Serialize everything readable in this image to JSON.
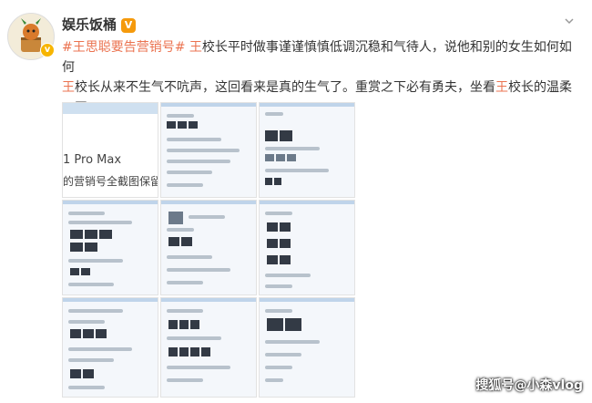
{
  "post": {
    "author": "娱乐饭桶",
    "vip_badge": "V",
    "text": {
      "hashtag": "#王思聪要告营销号#",
      "p1_hl": "王",
      "p1_rest": "校长平时做事谨谨慎慎低调沉稳和气待人，说他和别的女生如何如何",
      "p2_hl": "王",
      "p2_rest": "校长从来不生气不吭声，这回看来是真的生气了。重赏之下必有勇夫，坐看",
      "p2_hl2": "王",
      "p2_end": "校长的温柔一刀"
    }
  },
  "screenshots": {
    "tile1_line1": "1 Pro Max",
    "tile1_line2": "的营销号全截图保留"
  },
  "watermark": "搜狐号@小森vlog",
  "colors": {
    "accent": "#eb7350",
    "text": "#333333"
  }
}
